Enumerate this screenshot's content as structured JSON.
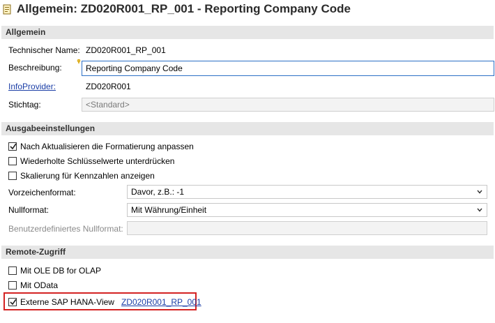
{
  "window": {
    "title": "Allgemein: ZD020R001_RP_001 - Reporting Company Code"
  },
  "sections": {
    "general": "Allgemein",
    "output": "Ausgabeeinstellungen",
    "remote": "Remote-Zugriff"
  },
  "general": {
    "tech_name_label": "Technischer Name:",
    "tech_name_value": "ZD020R001_RP_001",
    "description_label": "Beschreibung:",
    "description_value": "Reporting Company Code",
    "infoprovider_label": "InfoProvider:",
    "infoprovider_value": "ZD020R001",
    "keydate_label": "Stichtag:",
    "keydate_value": "<Standard>"
  },
  "output": {
    "checkboxes": [
      {
        "label": "Nach Aktualisieren die Formatierung anpassen",
        "checked": true
      },
      {
        "label": "Wiederholte Schlüsselwerte unterdrücken",
        "checked": false
      },
      {
        "label": "Skalierung für Kennzahlen anzeigen",
        "checked": false
      }
    ],
    "sign_format_label": "Vorzeichenformat:",
    "sign_format_value": "Davor, z.B.: -1",
    "zero_format_label": "Nullformat:",
    "zero_format_value": "Mit Währung/Einheit",
    "custom_zero_label": "Benutzerdefiniertes Nullformat:",
    "custom_zero_value": ""
  },
  "remote": {
    "checkboxes": [
      {
        "label": "Mit OLE DB for OLAP",
        "checked": false
      },
      {
        "label": "Mit OData",
        "checked": false
      },
      {
        "label": "Externe SAP HANA-View",
        "checked": true
      }
    ],
    "hana_view_link": "ZD020R001_RP_001"
  },
  "colors": {
    "section_bg": "#e6e6e6",
    "link": "#1a3da6",
    "highlight": "#d42222",
    "active_border": "#2b6fc6"
  },
  "icons": {
    "title": "query-document-icon",
    "dropdown": "chevron-down-icon",
    "required": "required-marker-icon",
    "check": "checkmark-icon"
  }
}
